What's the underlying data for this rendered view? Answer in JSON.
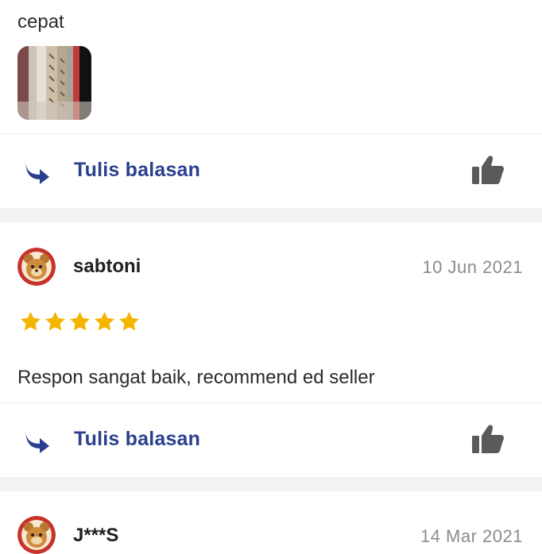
{
  "review1": {
    "comment_tail": "cepat",
    "reply_label": "Tulis balasan"
  },
  "review2": {
    "username": "sabtoni",
    "date": "10 Jun 2021",
    "rating": 5,
    "comment": "Respon sangat baik, recommend ed seller",
    "reply_label": "Tulis balasan"
  },
  "review3": {
    "username": "J***S",
    "date": "14 Mar 2021"
  },
  "colors": {
    "accent": "#2b3f8f",
    "star": "#f5b400",
    "like_icon": "#5a5a5a",
    "separator": "#f2f2f2"
  },
  "icons": [
    "reply-arrow-icon",
    "thumbs-up-icon",
    "star-icon",
    "avatar-bear-icon"
  ]
}
